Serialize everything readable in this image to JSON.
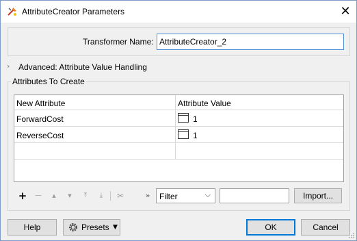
{
  "window": {
    "title": "AttributeCreator Parameters",
    "close_glyph": "✕",
    "icon": "fme-transformer-icon"
  },
  "transformer": {
    "label": "Transformer Name:",
    "value": "AttributeCreator_2"
  },
  "advanced": {
    "label": "Advanced: Attribute Value Handling",
    "expanded": false
  },
  "attributes": {
    "group_label": "Attributes To Create",
    "columns": [
      "New Attribute",
      "Attribute Value"
    ],
    "rows": [
      {
        "name": "ForwardCost",
        "value": "1"
      },
      {
        "name": "ReverseCost",
        "value": "1"
      }
    ]
  },
  "toolbar": {
    "add": "+",
    "remove": "—",
    "move_up": "▲",
    "move_down": "▼",
    "move_top": "⤒",
    "move_bottom": "⤓",
    "cut": "✂",
    "more": "»",
    "filter_value": "Filter",
    "filter_arrow": "⌵",
    "filter_text": "",
    "import_label": "Import..."
  },
  "buttons": {
    "help": "Help",
    "presets": "Presets",
    "presets_arrow": "▼",
    "ok": "OK",
    "cancel": "Cancel"
  },
  "colors": {
    "accent": "#0078d7",
    "input_focus": "#4a90d9"
  }
}
